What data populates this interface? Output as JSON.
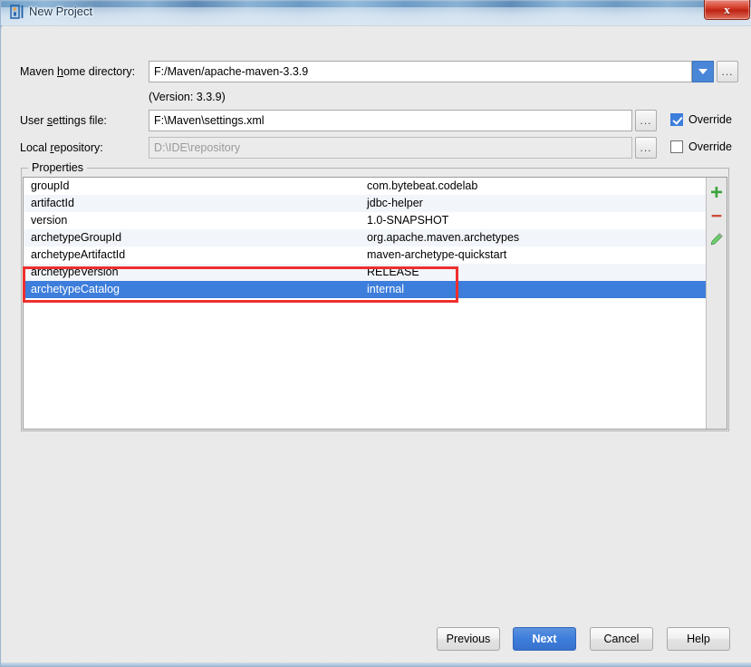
{
  "window": {
    "title": "New Project",
    "icon": "intellij-idea-icon",
    "close_label": "x"
  },
  "form": {
    "maven_home": {
      "label_before": "Maven ",
      "label_mnemonic": "h",
      "label_after": "ome directory:",
      "value": "F:/Maven/apache-maven-3.3.9",
      "browse_label": "...",
      "dropdown_icon": "chevron-down-icon"
    },
    "version_note": "(Version: 3.3.9)",
    "user_settings": {
      "label_before": "User ",
      "label_mnemonic": "s",
      "label_after": "ettings file:",
      "value": "F:\\Maven\\settings.xml",
      "browse_label": "...",
      "override_label": "Override",
      "override_checked": true
    },
    "local_repository": {
      "label_before": "Local ",
      "label_mnemonic": "r",
      "label_after": "epository:",
      "value": "D:\\IDE\\repository",
      "disabled": true,
      "browse_label": "...",
      "override_label": "Override",
      "override_checked": false
    }
  },
  "properties": {
    "legend": "Properties",
    "rows": [
      {
        "key": "groupId",
        "value": "com.bytebeat.codelab"
      },
      {
        "key": "artifactId",
        "value": "jdbc-helper"
      },
      {
        "key": "version",
        "value": "1.0-SNAPSHOT"
      },
      {
        "key": "archetypeGroupId",
        "value": "org.apache.maven.archetypes"
      },
      {
        "key": "archetypeArtifactId",
        "value": "maven-archetype-quickstart"
      },
      {
        "key": "archetypeVersion",
        "value": "RELEASE"
      },
      {
        "key": "archetypeCatalog",
        "value": "internal"
      }
    ],
    "selected_index": 6,
    "toolbar": [
      {
        "name": "add-property-icon",
        "glyph": "+",
        "color": "#3aa33a"
      },
      {
        "name": "remove-property-icon",
        "glyph": "–",
        "color": "#cc4b3c"
      },
      {
        "name": "edit-property-icon",
        "glyph": "✎",
        "color": "#4caf50"
      }
    ]
  },
  "annotation": {
    "color": "#ee2f2f"
  },
  "footer": {
    "previous": "Previous",
    "next": "Next",
    "cancel": "Cancel",
    "help": "Help"
  },
  "colors": {
    "accent": "#3d7ddb",
    "selection": "#3d7ddb",
    "annotation": "#ee2f2f",
    "close_button": "#bd2313"
  }
}
